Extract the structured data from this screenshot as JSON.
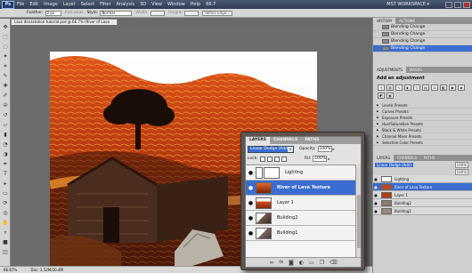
{
  "menu": {
    "logo": "Ps",
    "items": [
      "File",
      "Edit",
      "Image",
      "Layer",
      "Select",
      "Filter",
      "Analysis",
      "3D",
      "View",
      "Window",
      "Help"
    ],
    "zoom": "66.7",
    "workspace": "MST WORKSPACE ▾"
  },
  "options": {
    "feather_label": "Feather:",
    "feather_value": "0 px",
    "anti_alias_label": "Anti-alias",
    "style_label": "Style:",
    "style_value": "Normal",
    "width_label": "Width:",
    "height_label": "Height:",
    "refine_label": "Refine Edge..."
  },
  "document": {
    "tab_title": "Lava devastation tutorial.psd @ 66.7% (River of Lava Texture, RGB/8#) *"
  },
  "status": {
    "zoom": "66.67%",
    "doc_info": "Doc: 3.52M/20.4M"
  },
  "history": {
    "tabs": [
      "HISTORY",
      "ACTIONS"
    ],
    "rows": [
      "Blending Change",
      "Blending Change",
      "Blending Change",
      "Blending Change"
    ],
    "selected_index": 3
  },
  "adjustments": {
    "tabs": [
      "ADJUSTMENTS",
      "MASKS"
    ],
    "title": "Add an adjustment",
    "presets": [
      "Levels Presets",
      "Curves Presets",
      "Exposure Presets",
      "Hue/Saturation Presets",
      "Black & White Presets",
      "Channel Mixer Presets",
      "Selective Color Presets"
    ]
  },
  "dock_layers": {
    "tabs": [
      "LAYERS",
      "CHANNELS",
      "PATHS"
    ],
    "blend": "Linear Dodge (Add)",
    "opacity": "100%",
    "fill": "100%",
    "rows": [
      "Lighting",
      "River of Lava Texture",
      "Layer 1",
      "Building2",
      "Building1"
    ],
    "selected_index": 1
  },
  "layers_panel": {
    "tabs": [
      "LAYERS",
      "CHANNELS",
      "PATHS"
    ],
    "blend_mode": "Linear Dodge (Add)",
    "opacity_label": "Opacity:",
    "opacity_value": "100%",
    "lock_label": "Lock:",
    "fill_label": "Fill:",
    "fill_value": "100%",
    "layers": [
      {
        "name": "Lighting",
        "thumb": "adjustment"
      },
      {
        "name": "River of Lava Texture",
        "thumb": "lava"
      },
      {
        "name": "Layer 1",
        "thumb": "lava"
      },
      {
        "name": "Building2",
        "thumb": "building"
      },
      {
        "name": "Building1",
        "thumb": "building"
      }
    ],
    "selected_index": 1,
    "footer_icons": [
      "link-icon",
      "fx-icon",
      "mask-icon",
      "adjustment-icon",
      "folder-icon",
      "new-layer-icon",
      "trash-icon"
    ]
  },
  "colors": {
    "selection_blue": "#3b6ccf",
    "panel_border": "#5e5450"
  }
}
